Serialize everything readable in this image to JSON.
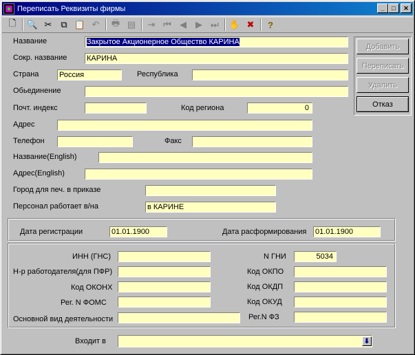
{
  "window": {
    "title": "Переписать Реквизиты фирмы"
  },
  "titlebar": {
    "minimize": "_",
    "maximize": "□",
    "close": "✕"
  },
  "toolbar": {
    "tools": [
      {
        "name": "new-doc-icon",
        "glyph": "🗋"
      },
      {
        "name": "find-icon",
        "glyph": "🔍"
      },
      {
        "name": "cut-icon",
        "glyph": "✂"
      },
      {
        "name": "copy-icon",
        "glyph": "⧉"
      },
      {
        "name": "paste-icon",
        "glyph": "📋"
      },
      {
        "name": "undo-icon",
        "glyph": "↶"
      },
      {
        "name": "print-icon",
        "glyph": "🖶"
      },
      {
        "name": "preview-icon",
        "glyph": "▤"
      },
      {
        "name": "go-record-icon",
        "glyph": "⇥"
      },
      {
        "name": "first-icon",
        "glyph": "⏮"
      },
      {
        "name": "prev-icon",
        "glyph": "◀"
      },
      {
        "name": "next-icon",
        "glyph": "▶"
      },
      {
        "name": "last-icon",
        "glyph": "⏭"
      },
      {
        "name": "hand-icon",
        "glyph": "✋"
      },
      {
        "name": "delete-doc-icon",
        "glyph": "✖"
      },
      {
        "name": "help-icon",
        "glyph": "?"
      }
    ]
  },
  "form": {
    "name_label": "Название",
    "name_value": "Закрытое Акционерное Общество КАРИНА",
    "short_name_label": "Сокр. название",
    "short_name_value": "КАРИНА",
    "country_label": "Страна",
    "country_value": "Россия",
    "republic_label": "Республика",
    "republic_value": "",
    "association_label": "Обьединение",
    "association_value": "",
    "postcode_label": "Почт. индекс",
    "postcode_value": "",
    "region_code_label": "Код региона",
    "region_code_value": "0",
    "address_label": "Адрес",
    "address_value": "",
    "phone_label": "Телефон",
    "phone_value": "",
    "fax_label": "Факс",
    "fax_value": "",
    "name_en_label": "Название(English)",
    "name_en_value": "",
    "address_en_label": "Адрес(English)",
    "address_en_value": "",
    "city_print_label": "Город для печ. в приказе",
    "city_print_value": "",
    "staff_works_label": "Персонал работает в/на",
    "staff_works_value": "в КАРИНЕ"
  },
  "buttons": {
    "add": "Добавить",
    "rewrite": "Переписать",
    "delete": "Удалить",
    "cancel": "Отказ"
  },
  "dates": {
    "registration_label": "Дата регистрации",
    "registration_value": "01.01.1900",
    "dissolution_label": "Дата расформирования",
    "dissolution_value": "01.01.1900"
  },
  "codes": {
    "inn_label": "ИНН (ГНС)",
    "inn_value": "",
    "employer_no_label": "Н-р работодателя(для ПФР)",
    "employer_no_value": "",
    "okonh_label": "Код ОКОНХ",
    "okonh_value": "",
    "foms_label": "Рег. N ФОМС",
    "foms_value": "",
    "main_activity_label": "Основной вид деятельности",
    "main_activity_value": "",
    "gni_label": "N ГНИ",
    "gni_value": "5034",
    "okpo_label": "Код ОКПО",
    "okpo_value": "",
    "okdp_label": "Код ОКДП",
    "okdp_value": "",
    "okud_label": "Код ОКУД",
    "okud_value": "",
    "fz_label": "Рег.N ФЗ",
    "fz_value": ""
  },
  "parent": {
    "label": "Входит в",
    "value": ""
  }
}
